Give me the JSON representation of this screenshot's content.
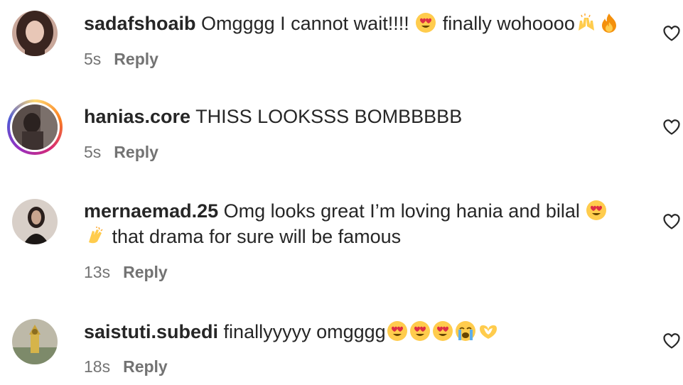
{
  "comments": [
    {
      "username": "sadafshoaib",
      "text": " Omgggg I cannot wait!!!! ",
      "text2": " finally wohoooo",
      "time": "5s",
      "reply": "Reply",
      "emojis": [
        "heart-eyes",
        "raising-hands",
        "fire"
      ]
    },
    {
      "username": "hanias.core",
      "text": " THISS LOOKSSS BOMBBBBB",
      "time": "5s",
      "reply": "Reply",
      "has_story_ring": true
    },
    {
      "username": "mernaemad.25",
      "text": " Omg looks great I’m loving hania and bilal ",
      "text2": " that drama for sure will be famous",
      "time": "13s",
      "reply": "Reply",
      "emojis": [
        "heart-eyes",
        "clapping-hands"
      ]
    },
    {
      "username": "saistuti.subedi",
      "text": " finallyyyyy omgggg",
      "time": "18s",
      "reply": "Reply",
      "emojis": [
        "heart-eyes",
        "heart-eyes",
        "heart-eyes",
        "loudly-crying",
        "heart-hands"
      ]
    }
  ]
}
